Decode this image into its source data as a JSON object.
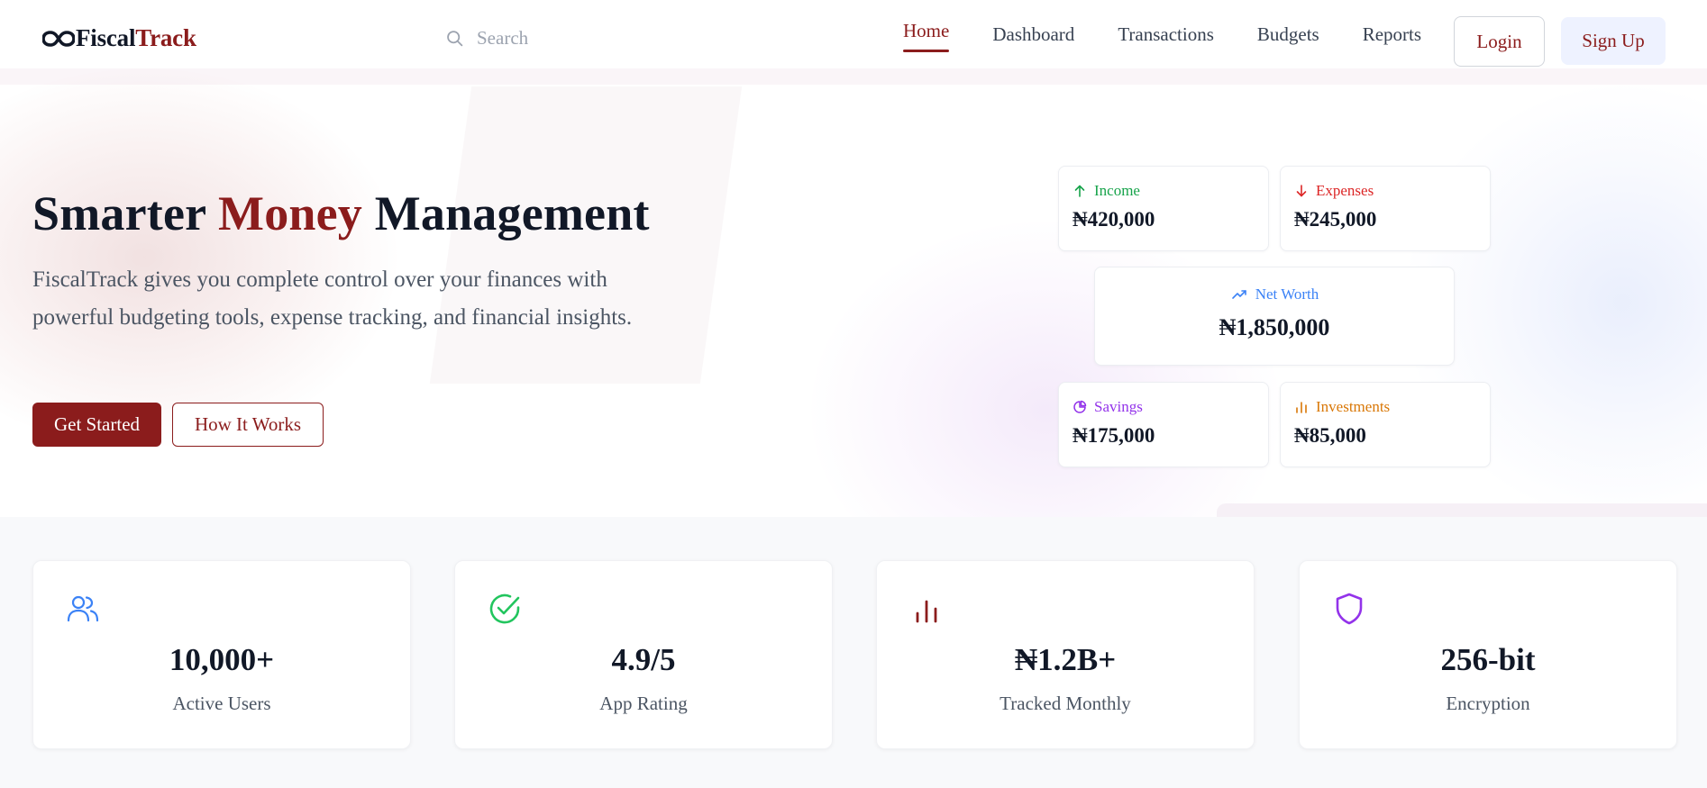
{
  "brand": {
    "name_part1": "Fiscal",
    "name_part2": "Track"
  },
  "search": {
    "placeholder": "Search"
  },
  "nav": {
    "links": [
      "Home",
      "Dashboard",
      "Transactions",
      "Budgets",
      "Reports"
    ],
    "active": "Home",
    "login_label": "Login",
    "signup_label": "Sign Up"
  },
  "hero": {
    "title_part1": "Smarter",
    "title_accent": "Money",
    "title_part2": "Management",
    "description": "FiscalTrack gives you complete control over your finances with powerful budgeting tools, expense tracking, and financial insights.",
    "primary_button": "Get Started",
    "secondary_button": "How It Works"
  },
  "summary": {
    "income": {
      "label": "Income",
      "value": "₦420,000",
      "color": "#16a34a",
      "icon": "arrow-up-icon"
    },
    "expenses": {
      "label": "Expenses",
      "value": "₦245,000",
      "color": "#dc2626",
      "icon": "arrow-down-icon"
    },
    "net_worth": {
      "label": "Net Worth",
      "value": "₦1,850,000",
      "color": "#3b82f6",
      "icon": "trending-up-icon"
    },
    "savings": {
      "label": "Savings",
      "value": "₦175,000",
      "color": "#9333ea",
      "icon": "pie-chart-icon"
    },
    "investments": {
      "label": "Investments",
      "value": "₦85,000",
      "color": "#d97706",
      "icon": "bar-chart-icon"
    }
  },
  "stats": [
    {
      "value": "10,000+",
      "label": "Active Users",
      "icon": "users-icon",
      "color": "#3b82f6"
    },
    {
      "value": "4.9/5",
      "label": "App Rating",
      "icon": "check-circle-icon",
      "color": "#22c55e"
    },
    {
      "value": "₦1.2B+",
      "label": "Tracked Monthly",
      "icon": "bar-chart-icon",
      "color": "#8b1c1c"
    },
    {
      "value": "256-bit",
      "label": "Encryption",
      "icon": "shield-icon",
      "color": "#9333ea"
    }
  ],
  "theme": {
    "accent": "#8b1c1c",
    "text": "#111827"
  }
}
